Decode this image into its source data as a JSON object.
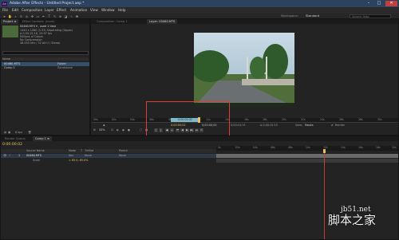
{
  "window": {
    "title": "Adobe After Effects - Untitled Project.aep *",
    "app_icon": "Ae",
    "minimize": "–",
    "maximize": "□",
    "close": "✕"
  },
  "menu": [
    "File",
    "Edit",
    "Composition",
    "Layer",
    "Effect",
    "Animation",
    "View",
    "Window",
    "Help"
  ],
  "toolbar": {
    "workspace_label": "Workspace:",
    "workspace_value": "Standard",
    "search_placeholder": "Search Help"
  },
  "project_panel": {
    "tabs": [
      "Project ≡",
      "Effect Controls: (none)"
    ],
    "footage_name": "00460.MTS ▾ , used 1 time",
    "info_lines": [
      "1440 x 1080 (1.33) Separating (Upper)",
      "Δ 0;00;15;18, 29.97 fps",
      "Millions of Colors",
      "No Compression",
      "48.000 kHz / 32 bit U / Stereo"
    ],
    "search_placeholder": "",
    "col_name": "Name",
    "col_type": "",
    "items": [
      {
        "name": "00460.MTS",
        "type": "Folder"
      },
      {
        "name": "Comp 1",
        "type": "Sandstone"
      }
    ],
    "bpc": "8 bpc"
  },
  "composition_panel": {
    "tabs": [
      "Composition: Comp 1",
      "Layer: 00460.MTS"
    ],
    "ruler_ticks": [
      "00s",
      "02s",
      "04s",
      "06s",
      "08s",
      "10s",
      "12s",
      "14s",
      "16s",
      "18s",
      "20s",
      "22s",
      "24s",
      "26s",
      "28s",
      "30s"
    ],
    "zoom": "33%",
    "current_time": "0;00:00;02",
    "in_time": "0;00:00;00",
    "out_time": "0;00:15:15",
    "duration": "Δ 0;00:15:15",
    "view_label": "View:",
    "view_value": "Masks",
    "render_label": "Render",
    "work_area_label": "0:00:04:02"
  },
  "timeline_panel": {
    "tabs": [
      "Render Queue",
      "Comp 1 ≡"
    ],
    "time_display": "0:00:00:02",
    "columns": [
      "Source Name",
      "Mode",
      "T",
      "TrkMat",
      "Parent"
    ],
    "layers": [
      {
        "num": "1",
        "name": "00460.MTS",
        "mode": "Nor",
        "trkmat": "None",
        "parent": "None"
      }
    ],
    "transform_label": "Scale",
    "transform_value": "∞ 65.0, 65.0%",
    "ruler_ticks": [
      "0s",
      "02s",
      "04s",
      "06s",
      "08s",
      "10s",
      "12s",
      "14s",
      "16s",
      "18s",
      "20s"
    ]
  },
  "watermark": {
    "url": "jb51.net",
    "text": "脚本之家"
  },
  "colors": {
    "accent": "#e8c060",
    "title_bar": "#2b4260",
    "panel_bg": "#232323",
    "red_box": "#e23b32",
    "playhead": "#c83b32"
  }
}
